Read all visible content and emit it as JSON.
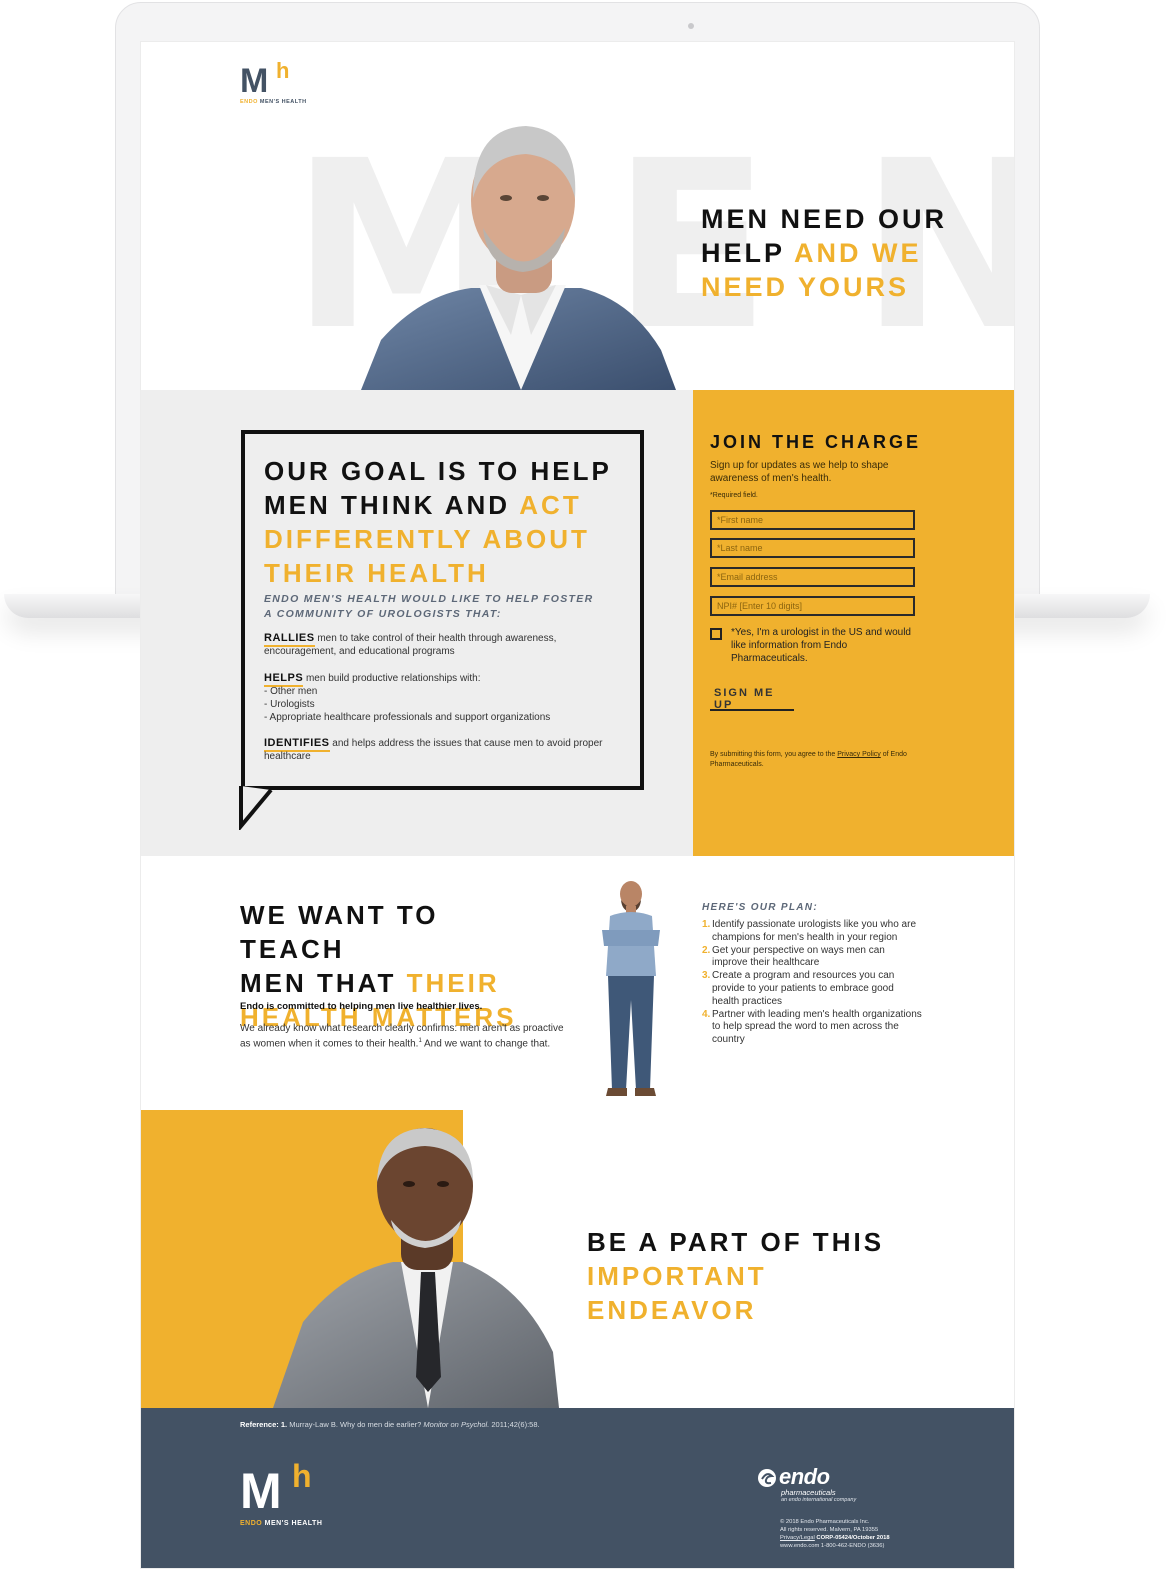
{
  "brand": {
    "logo_mark": "M",
    "logo_h": "h",
    "logo_caption_accent": "ENDO",
    "logo_caption_rest": " MEN'S HEALTH",
    "accent_color": "#f0b12e",
    "footer_color": "#435264"
  },
  "hero": {
    "bg_word": "MEN",
    "title_line1": "MEN NEED OUR",
    "title_line2_dark": "HELP ",
    "title_line2_accent": "AND WE",
    "title_line3_accent": "NEED YOURS"
  },
  "goal": {
    "title_line1": "OUR GOAL IS TO HELP",
    "title_line2_dark": "MEN THINK AND ",
    "title_line2_accent": "ACT",
    "title_line3_accent": "DIFFERENTLY ABOUT",
    "title_line4_accent": "THEIR HEALTH",
    "subtitle": "Endo Men's Health would like to help foster a community of urologists that:",
    "items": [
      {
        "keyword": "RALLIES",
        "text": " men to take control of their health through awareness, encouragement, and educational programs"
      },
      {
        "keyword": "HELPS",
        "text": " men build productive relationships with:",
        "bullets": [
          "- Other men",
          "- Urologists",
          "- Appropriate healthcare professionals and support organizations"
        ]
      },
      {
        "keyword": "IDENTIFIES",
        "text": " and helps address the issues that cause men to avoid proper healthcare"
      }
    ]
  },
  "join": {
    "title": "JOIN THE CHARGE",
    "subtitle": "Sign up for updates as we help to shape awareness of men's health.",
    "required_note": "*Required field.",
    "fields": {
      "first_name": "*First name",
      "last_name": "*Last name",
      "email": "*Email address",
      "npi": "NPI# [Enter 10 digits]"
    },
    "checkbox_label": "*Yes, I'm a urologist in the US and would like information from Endo Pharmaceuticals.",
    "submit_label": "SIGN ME UP",
    "privacy_prefix": "By submitting this form, you agree to the ",
    "privacy_link": "Privacy Policy",
    "privacy_suffix": " of Endo Pharmaceuticals."
  },
  "teach": {
    "title_line1": "WE WANT TO TEACH",
    "title_line2_dark": "MEN THAT ",
    "title_line2_accent": "THEIR",
    "title_line3_accent": "HEALTH MATTERS",
    "bold_line": "Endo is committed to helping men live healthier lives.",
    "body_before": "We already know what research clearly confirms: men aren't as proactive as women when it comes to their health.",
    "body_sup": "1",
    "body_after": " And we want to change that.",
    "plan_title": "Here's our plan:",
    "plan_items": [
      {
        "num": "1.",
        "text": "Identify passionate urologists like you who are champions for men's health in your region"
      },
      {
        "num": "2.",
        "text": "Get your perspective on ways men can improve their healthcare"
      },
      {
        "num": "3.",
        "text": "Create a program and resources you can provide to your patients to embrace good health practices"
      },
      {
        "num": "4.",
        "text": "Partner with leading men's health organizations to help spread the word to men across the country"
      }
    ]
  },
  "endeavor": {
    "title_line1": "BE A PART OF THIS",
    "title_line2_accent": "IMPORTANT ENDEAVOR"
  },
  "footer": {
    "reference_label": "Reference: 1.",
    "reference_text": " Murray-Law B. Why do men die earlier? ",
    "reference_journal": "Monitor on Psychol.",
    "reference_tail": " 2011;42(6):58.",
    "endo_word": "endo",
    "endo_sub1": "pharmaceuticals",
    "endo_sub2": "an endo international company",
    "legal_line1": "© 2018 Endo Pharmaceuticals Inc.",
    "legal_line2": "All rights reserved. Malvern, PA 19355",
    "legal_link": "Privacy/Legal",
    "legal_code": " CORP-05424/October 2018",
    "legal_line4": "www.endo.com 1-800-462-ENDO (3636)"
  }
}
